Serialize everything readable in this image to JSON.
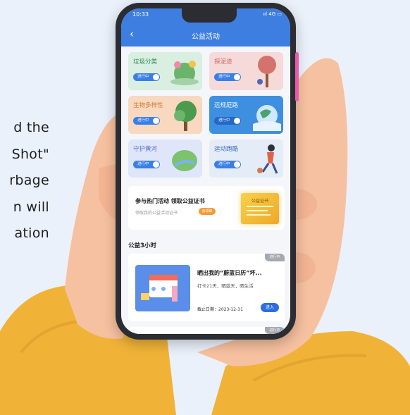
{
  "background_text": {
    "lines": [
      "d the",
      "Shot\"",
      "rbage",
      "n will",
      "ation"
    ]
  },
  "status_bar": {
    "time": "10:33",
    "icons": "ııl 4G ▭"
  },
  "header": {
    "back_icon": "chevron-left-icon",
    "title": "公益活动"
  },
  "categories": [
    {
      "label": "垃圾分类",
      "button": "进行中"
    },
    {
      "label": "探泥迹",
      "button": "进行中"
    },
    {
      "label": "生物多样性",
      "button": "进行中"
    },
    {
      "label": "远规庭路",
      "button": "进行中"
    },
    {
      "label": "守护黄河",
      "button": "进行中"
    },
    {
      "label": "运动跑酷",
      "button": "进行中"
    }
  ],
  "banner": {
    "title": "参与热门活动 领取公益证书",
    "subtitle": "领取我的公益活动证书",
    "button": "去领取",
    "certificate_text": "公益证书"
  },
  "section": {
    "title": "公益3小时"
  },
  "activity": {
    "badge": "进行中",
    "title": "晒出我的“蔚蓝日历”坏...",
    "desc": "打卡21天，晒蓝天，晒生活",
    "deadline_label": "截止日期：",
    "deadline": "2023-12-31",
    "button": "进入",
    "badge2": "进行中"
  },
  "colors": {
    "header": "#3d7ee0",
    "accent_blue": "#3a7fe8",
    "accent_orange": "#f59a33",
    "sleeve": "#f0b338",
    "skin": "#f6c1a0"
  }
}
